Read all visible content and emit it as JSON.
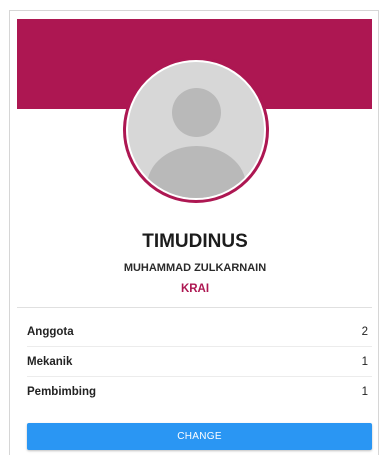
{
  "profile": {
    "team_name": "TIMUDINUS",
    "leader_name": "MUHAMMAD ZULKARNAIN",
    "region": "KRAI",
    "avatar_icon": "user-placeholder-icon"
  },
  "stats": [
    {
      "label": "Anggota",
      "value": "2"
    },
    {
      "label": "Mekanik",
      "value": "1"
    },
    {
      "label": "Pembimbing",
      "value": "1"
    }
  ],
  "actions": {
    "change_label": "CHANGE"
  },
  "colors": {
    "accent": "#ad1752",
    "button": "#2a96f3",
    "avatar_bg": "#d7d7d7",
    "avatar_fg": "#b9b9b9"
  }
}
